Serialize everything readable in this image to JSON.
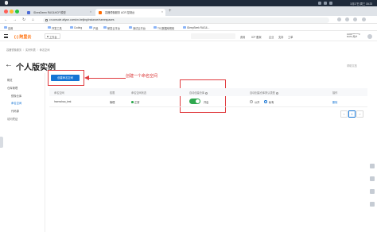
{
  "system_bar": {
    "clock": "1月17日 周三 18:23"
  },
  "browser": {
    "tabs": [
      {
        "label": "IDnesDeem RAG&HCP 模型",
        "active": false,
        "favicon_color": "#4b6bd6"
      },
      {
        "label": "容器镜像服务 ACR 控制台",
        "active": true,
        "favicon_color": "#ff6a00"
      }
    ],
    "address": "cr.console.aliyun.com/cn-beijing/instance/namespaces",
    "bookmarks": [
      {
        "label": "应用"
      },
      {
        "label": "开发工具"
      },
      {
        "label": "Coding"
      },
      {
        "label": "产品"
      },
      {
        "label": "研发云平台"
      },
      {
        "label": "测试云平台"
      },
      {
        "label": "TS-数据库规则"
      },
      {
        "label": "IDeepSeek RAG&..."
      }
    ]
  },
  "console": {
    "logo": "(-) 阿里云",
    "workspace": "工作台",
    "top_nav": [
      "费用",
      "ICP 备案",
      "企业",
      "支持",
      "工单"
    ],
    "account": {
      "line1": "1009*******3",
      "line2": "RAM 用户"
    }
  },
  "breadcrumb": [
    "容器镜像服务",
    "实例列表",
    "命名空间"
  ],
  "page_title": "个人版实例",
  "help_link": "帮助文档",
  "sidebar": {
    "items": [
      {
        "label": "概览",
        "level": 0,
        "active": false
      },
      {
        "label": "仓库管理",
        "level": 0,
        "active": false
      },
      {
        "label": "镜像仓库",
        "level": 1,
        "active": false
      },
      {
        "label": "命名空间",
        "level": 1,
        "active": true
      },
      {
        "label": "代码源",
        "level": 1,
        "active": false
      },
      {
        "label": "访问凭证",
        "level": 0,
        "active": false
      }
    ]
  },
  "toolbar": {
    "create_namespace_label": "创建命名空间"
  },
  "annotation": {
    "callout_text": "创建一个命名空间",
    "color": "#e03a3e"
  },
  "table": {
    "headers": {
      "name": "命名空间",
      "role": "权限",
      "status": "命名空间状态",
      "auto_create": "自动创建仓库",
      "default_type": "自动创建仓库默认类型",
      "actions": "操作"
    },
    "rows": [
      {
        "name": "hwenchao_test",
        "role": "管理",
        "status": "正常",
        "auto_create_on": true,
        "auto_create_label": "开启",
        "default_type_options": [
          "公开",
          "私有"
        ],
        "default_type_selected": "私有",
        "action": "删除"
      }
    ]
  },
  "pagination": {
    "prev": "<",
    "current": "1",
    "next": ">"
  },
  "colors": {
    "primary": "#1474d4",
    "brand": "#ff6a00",
    "success": "#2fa84f",
    "annotation": "#e03a3e"
  }
}
